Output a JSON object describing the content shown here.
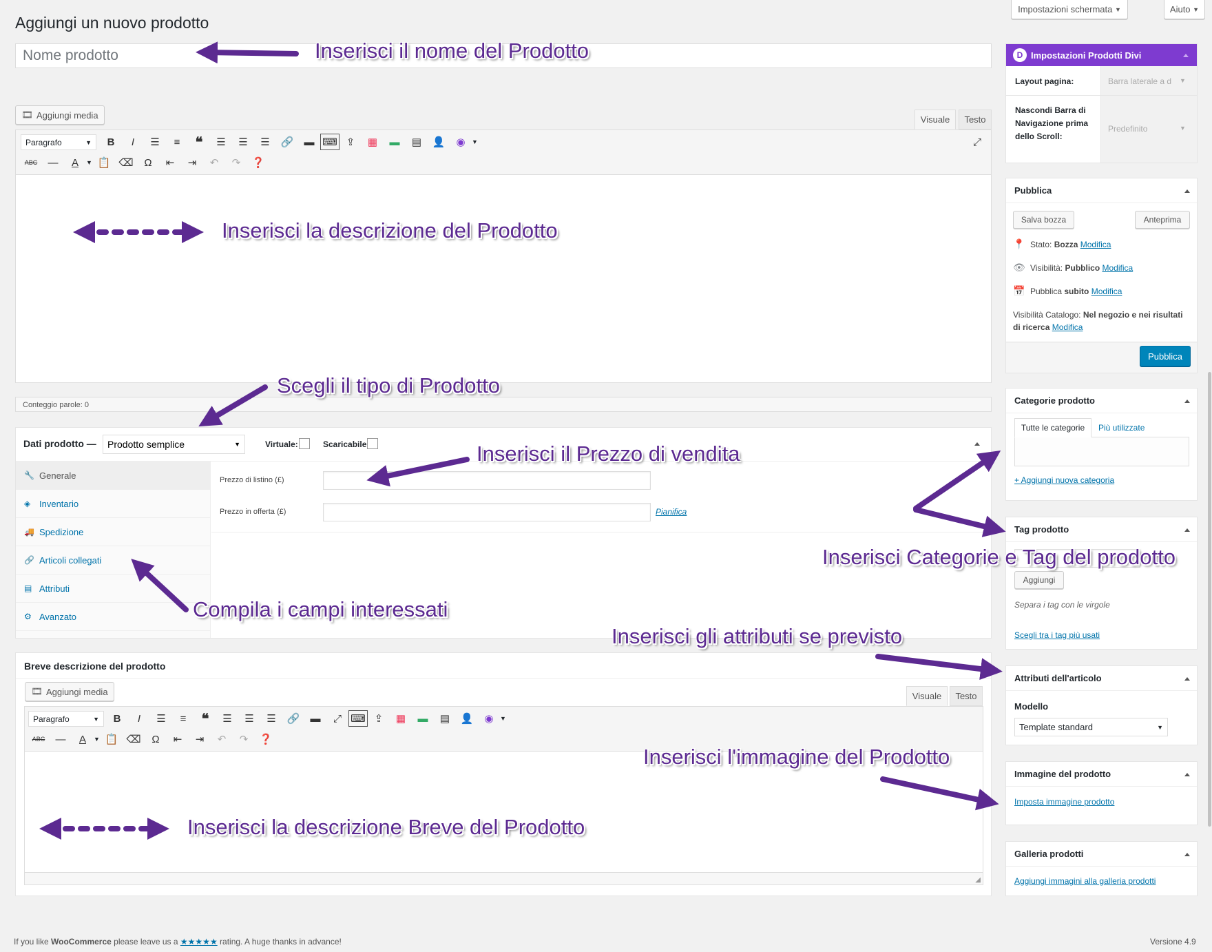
{
  "top_buttons": {
    "screen_options": "Impostazioni schermata",
    "help": "Aiuto"
  },
  "page_title": "Aggiungi un nuovo prodotto",
  "title_field": {
    "placeholder": "Nome prodotto"
  },
  "editor": {
    "add_media": "Aggiungi media",
    "tab_visual": "Visuale",
    "tab_text": "Testo",
    "format_select": "Paragrafo",
    "word_count": "Conteggio parole: 0"
  },
  "product_data": {
    "label": "Dati prodotto —",
    "type_select": "Prodotto semplice",
    "virtual_label": "Virtuale:",
    "downloadable_label": "Scaricabile:",
    "tabs": [
      {
        "label": "Generale",
        "icon": "wrench-icon"
      },
      {
        "label": "Inventario",
        "icon": "tag-icon"
      },
      {
        "label": "Spedizione",
        "icon": "truck-icon"
      },
      {
        "label": "Articoli collegati",
        "icon": "link-icon"
      },
      {
        "label": "Attributi",
        "icon": "list-icon"
      },
      {
        "label": "Avanzato",
        "icon": "gear-icon"
      }
    ],
    "regular_price_label": "Prezzo di listino (£)",
    "sale_price_label": "Prezzo in offerta (£)",
    "schedule_link": "Pianifica"
  },
  "short_description": {
    "title": "Breve descrizione del prodotto",
    "add_media": "Aggiungi media",
    "tab_visual": "Visuale",
    "tab_text": "Testo",
    "format_select": "Paragrafo"
  },
  "divi_box": {
    "title": "Impostazioni Prodotti Divi",
    "layout_label": "Layout pagina:",
    "layout_value": "Barra laterale a d",
    "nav_label": "Nascondi Barra di Navigazione prima dello Scroll:",
    "nav_value": "Predefinito",
    "accent_color": "#7e3bd0"
  },
  "publish_box": {
    "title": "Pubblica",
    "save_draft": "Salva bozza",
    "preview": "Anteprima",
    "status_label": "Stato:",
    "status_value": "Bozza",
    "visibility_label": "Visibilità:",
    "visibility_value": "Pubblico",
    "publish_label": "Pubblica",
    "publish_value": "subito",
    "catalog_label": "Visibilità Catalogo:",
    "catalog_value": "Nel negozio e nei risultati di ricerca",
    "edit_link": "Modifica",
    "publish_button": "Pubblica",
    "publish_color": "#0085ba"
  },
  "categories_box": {
    "title": "Categorie prodotto",
    "tab_all": "Tutte le categorie",
    "tab_popular": "Più utilizzate",
    "add_link": "+ Aggiungi nuova categoria"
  },
  "tags_box": {
    "title": "Tag prodotto",
    "add_button": "Aggiungi",
    "hint": "Separa i tag con le virgole",
    "choose_link": "Scegli tra i tag più usati"
  },
  "attributes_box": {
    "title": "Attributi dell'articolo",
    "model_label": "Modello",
    "model_value": "Template standard"
  },
  "image_box": {
    "title": "Immagine del prodotto",
    "set_link": "Imposta immagine prodotto"
  },
  "gallery_box": {
    "title": "Galleria prodotti",
    "add_link": "Aggiungi immagini alla galleria prodotti"
  },
  "footer": {
    "text_before": "If you like ",
    "brand": "WooCommerce",
    "text_mid": " please leave us a ",
    "stars": "★★★★★",
    "text_after": " rating. A huge thanks in advance!",
    "version": "Versione 4.9"
  },
  "annotations": {
    "name": "Inserisci il nome del Prodotto",
    "description": "Inserisci la descrizione del Prodotto",
    "type": "Scegli il tipo di Prodotto",
    "price": "Inserisci il Prezzo di vendita",
    "fields": "Compila i campi interessati",
    "categories_tags": "Inserisci Categorie e Tag del prodotto",
    "attributes": "Inserisci gli attributi se previsto",
    "image": "Inserisci l'immagine del Prodotto",
    "short_description": "Inserisci la descrizione Breve del Prodotto",
    "color": "#5c2a91"
  }
}
